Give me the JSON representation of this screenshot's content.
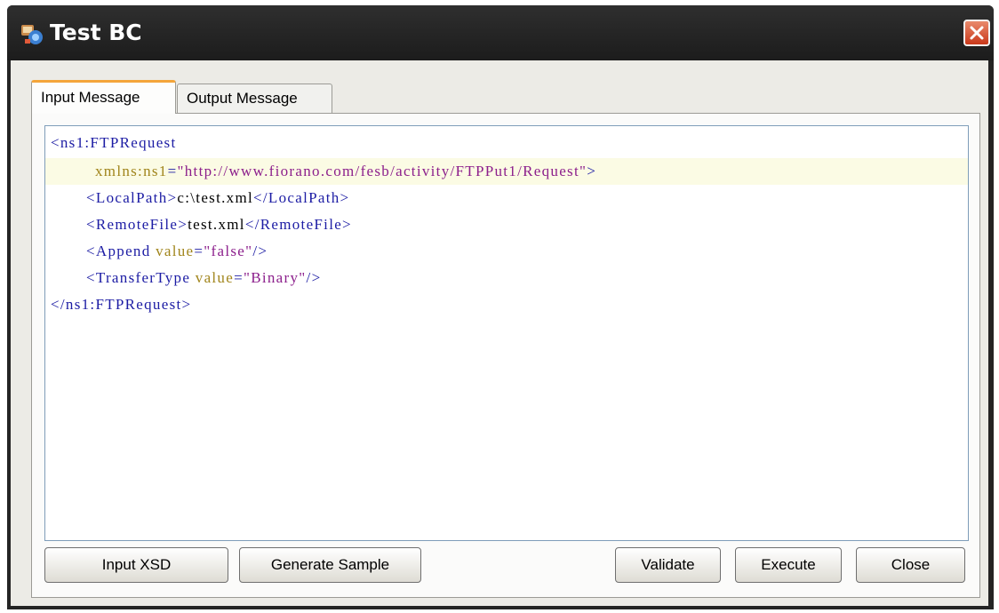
{
  "window": {
    "title": "Test BC",
    "icon": "app-icon"
  },
  "tabs": [
    {
      "label": "Input Message",
      "active": true
    },
    {
      "label": "Output Message",
      "active": false
    }
  ],
  "editor": {
    "lines": [
      [
        {
          "t": "<ns1:FTPRequest",
          "c": "tag"
        }
      ],
      [
        {
          "t": "xmlns:ns1",
          "c": "attr"
        },
        {
          "t": "=",
          "c": "tag"
        },
        {
          "t": "\"http://www.fiorano.com/fesb/activity/FTPPut1/Request\"",
          "c": "val"
        },
        {
          "t": ">",
          "c": "tag"
        }
      ],
      [
        {
          "t": "<LocalPath>",
          "c": "tag"
        },
        {
          "t": "c:\\test.xml",
          "c": "txt"
        },
        {
          "t": "</LocalPath>",
          "c": "tag"
        }
      ],
      [
        {
          "t": "<RemoteFile>",
          "c": "tag"
        },
        {
          "t": "test.xml",
          "c": "txt"
        },
        {
          "t": "</RemoteFile>",
          "c": "tag"
        }
      ],
      [
        {
          "t": "<Append ",
          "c": "tag"
        },
        {
          "t": "value",
          "c": "attr"
        },
        {
          "t": "=",
          "c": "tag"
        },
        {
          "t": "\"false\"",
          "c": "val"
        },
        {
          "t": "/>",
          "c": "tag"
        }
      ],
      [
        {
          "t": "<TransferType ",
          "c": "tag"
        },
        {
          "t": "value",
          "c": "attr"
        },
        {
          "t": "=",
          "c": "tag"
        },
        {
          "t": "\"Binary\"",
          "c": "val"
        },
        {
          "t": "/>",
          "c": "tag"
        }
      ],
      [
        {
          "t": "</ns1:FTPRequest>",
          "c": "tag"
        }
      ]
    ],
    "highlighted_line": 2
  },
  "buttons": {
    "input_xsd": "Input XSD",
    "generate_sample": "Generate Sample",
    "validate": "Validate",
    "execute": "Execute",
    "close": "Close"
  },
  "colors": {
    "tag": "#1c1ca4",
    "attribute": "#a1851c",
    "value": "#8c1f8c",
    "active_tab_accent": "#f4a53a",
    "close_button": "#d24a26"
  }
}
